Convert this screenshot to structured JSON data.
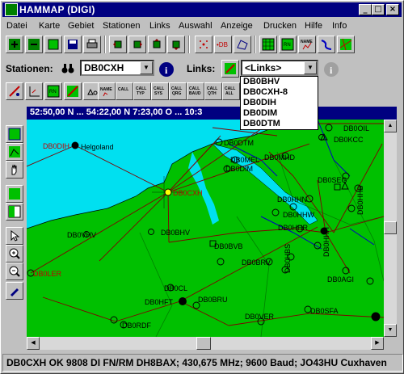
{
  "window": {
    "title": "HAMMAP  (DIGI)",
    "min": "_",
    "max": "□",
    "close": "×"
  },
  "menu": [
    "Datei",
    "Karte",
    "Gebiet",
    "Stationen",
    "Links",
    "Auswahl",
    "Anzeige",
    "Drucken",
    "Hilfe",
    "Info"
  ],
  "stations_label": "Stationen:",
  "stations_value": "DB0CXH",
  "links_label": "Links:",
  "links_value": "<Links>",
  "links_options": [
    "DB0BHV",
    "DB0CXH-8",
    "DB0DIH",
    "DB0DIM",
    "DB0DTM"
  ],
  "toolbar_labels": {
    "name": "NAME",
    "call": "CALL",
    "typ": "TYP",
    "sys": "SYS",
    "qrg": "QRG",
    "baud": "BAUD",
    "qth": "QTH",
    "all": "ALL"
  },
  "map_caption": "52:50,00 N ... 54:22,00 N     7:23,00 O ... 10:3",
  "nodes": {
    "DB0DIH": "DB0DIH",
    "Helgoland": "Helgoland",
    "DB0CXH": "DB0CXH",
    "DB0VHV": "DB0VHV",
    "DB0BHV": "DB0BHV",
    "DB0LER": "DB0LER",
    "DB0DTM": "DB0DTM",
    "DB0MEL": "DB0MEL",
    "DB0DIM": "DB0DIM",
    "DB0MHD": "DB0MHD",
    "DB0OIL": "DB0OIL",
    "DB0KCC": "DB0KCC",
    "DB0SEG": "DB0SEG",
    "DB0HHN": "DB0HHN",
    "DB0HHW": "DB0HHW",
    "DB0BVB": "DB0BVB",
    "DB0BRV": "DB0BRV",
    "DB0AGI": "DB0AGI",
    "DB0CL": "DB0CL",
    "DB0HFT": "DB0HFT",
    "DB0BRU": "DB0BRU",
    "DB0VER": "DB0VER",
    "DB0SFA": "DB0SFA",
    "DB0RDF": "DB0RDF",
    "DB0HBS": "DB0HBS",
    "DB0HHB": "DB0HHB",
    "DB0HHR": "DB0HHR",
    "DB0HHH": "DB0HHH"
  },
  "status": "DB0CXH OK 9808 DI FN/RM DH8BAX; 430,675 MHz; 9600 Baud; JO43HU Cuxhaven",
  "colors": {
    "title": "#000080",
    "land": "#00c000",
    "sea": "#00e0f0",
    "link": "#800000"
  }
}
